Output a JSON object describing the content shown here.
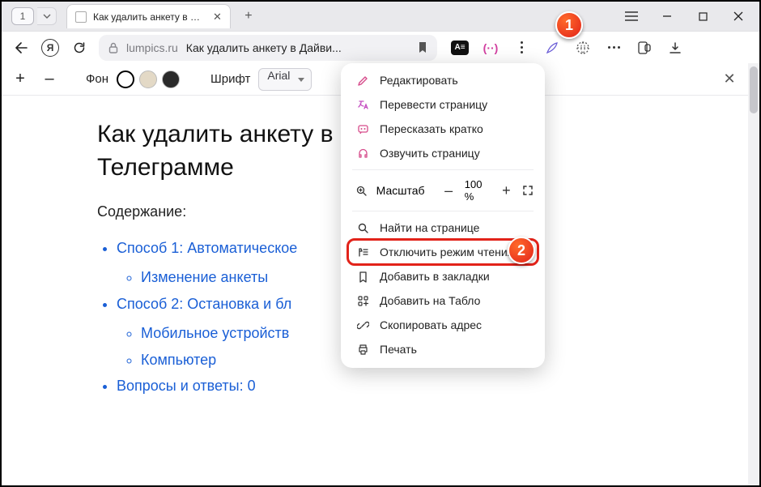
{
  "window": {
    "tab_index": "1",
    "tab_title": "Как удалить анкету в Д…",
    "menu_icon": "≡",
    "minimize": "—",
    "maximize": "□",
    "close": "✕"
  },
  "toolbar": {
    "home_letter": "Я",
    "domain": "lumpics.ru",
    "page_title": "Как удалить анкету в Дайви...",
    "reader_badge": "A≡"
  },
  "readerbar": {
    "plus": "+",
    "minus": "–",
    "bg_label": "Фон",
    "font_label": "Шрифт",
    "font_value": "Arial",
    "close": "✕"
  },
  "article": {
    "heading": "Как удалить анкету в Дайвинчике в Телеграмме",
    "heading_visible": "Как удалить анкету в",
    "heading_line2": "Телеграмме",
    "toc_title": "Содержание:",
    "toc": [
      {
        "label": "Способ 1: Автоматическое",
        "children": [
          {
            "label": "Изменение анкеты"
          }
        ]
      },
      {
        "label": "Способ 2: Остановка и бл",
        "children": [
          {
            "label": "Мобильное устройств"
          },
          {
            "label": "Компьютер"
          }
        ]
      },
      {
        "label": "Вопросы и ответы: 0",
        "children": []
      }
    ]
  },
  "menu": {
    "edit": "Редактировать",
    "translate": "Перевести страницу",
    "summarize": "Пересказать кратко",
    "voice": "Озвучить страницу",
    "zoom_label": "Масштаб",
    "zoom_value": "100 %",
    "find": "Найти на странице",
    "reader_off": "Отключить режим чтения",
    "bookmark": "Добавить в закладки",
    "tablo": "Добавить на Табло",
    "copy": "Скопировать адрес",
    "print": "Печать"
  },
  "annotations": {
    "one": "1",
    "two": "2"
  }
}
